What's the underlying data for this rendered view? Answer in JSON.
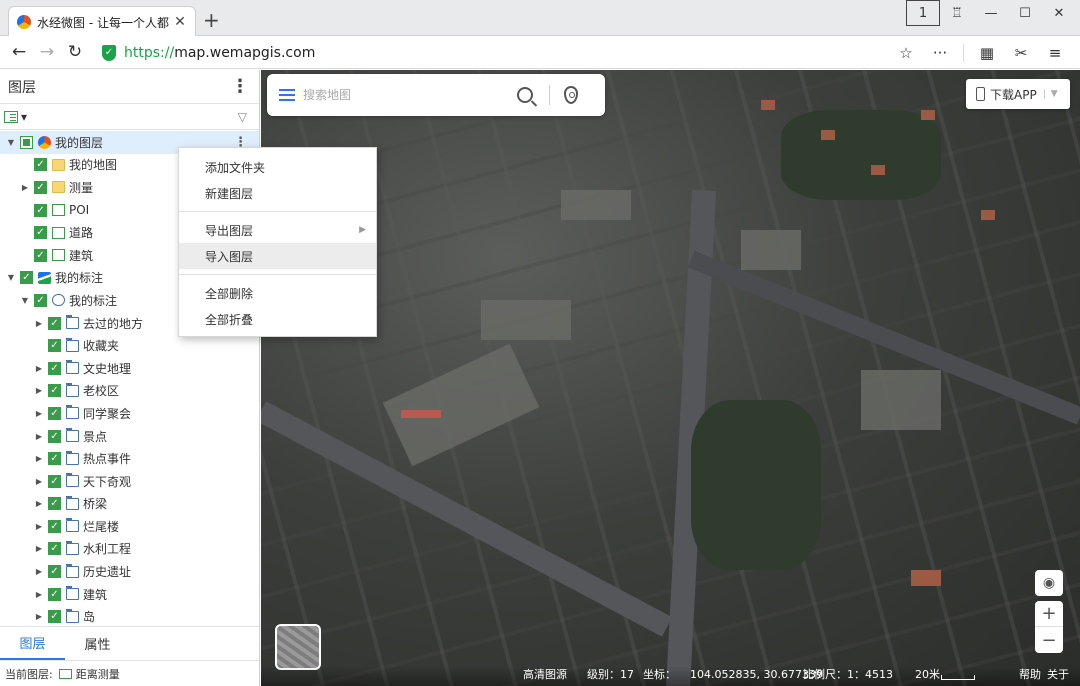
{
  "browser": {
    "tab_title": "水经微图 - 让每一个人都有自",
    "url_scheme": "https://",
    "url_rest": "map.wemapgis.com"
  },
  "panel": {
    "title": "图层",
    "tree": [
      {
        "label": "我的图层",
        "level": 0,
        "arrow": "▼",
        "check": "partial",
        "icon": "globe",
        "selected": true
      },
      {
        "label": "我的地图",
        "level": 1,
        "arrow": "",
        "check": "on",
        "icon": "folder-y"
      },
      {
        "label": "测量",
        "level": 1,
        "arrow": "▶",
        "check": "on",
        "icon": "folder-y"
      },
      {
        "label": "POI",
        "level": 1,
        "arrow": "",
        "check": "on",
        "icon": "poi"
      },
      {
        "label": "道路",
        "level": 1,
        "arrow": "",
        "check": "on",
        "icon": "road"
      },
      {
        "label": "建筑",
        "level": 1,
        "arrow": "",
        "check": "on",
        "icon": "bld"
      },
      {
        "label": "我的标注",
        "level": 0,
        "arrow": "▼",
        "check": "on",
        "icon": "mark"
      },
      {
        "label": "我的标注",
        "level": 1,
        "arrow": "▼",
        "check": "on",
        "icon": "cloud"
      },
      {
        "label": "去过的地方",
        "level": 2,
        "arrow": "▶",
        "check": "on",
        "icon": "folder-b"
      },
      {
        "label": "收藏夹",
        "level": 2,
        "arrow": "",
        "check": "on",
        "icon": "folder-b"
      },
      {
        "label": "文史地理",
        "level": 2,
        "arrow": "▶",
        "check": "on",
        "icon": "folder-b"
      },
      {
        "label": "老校区",
        "level": 2,
        "arrow": "▶",
        "check": "on",
        "icon": "folder-b"
      },
      {
        "label": "同学聚会",
        "level": 2,
        "arrow": "▶",
        "check": "on",
        "icon": "folder-b"
      },
      {
        "label": "景点",
        "level": 2,
        "arrow": "▶",
        "check": "on",
        "icon": "folder-b"
      },
      {
        "label": "热点事件",
        "level": 2,
        "arrow": "▶",
        "check": "on",
        "icon": "folder-b"
      },
      {
        "label": "天下奇观",
        "level": 2,
        "arrow": "▶",
        "check": "on",
        "icon": "folder-b"
      },
      {
        "label": "桥梁",
        "level": 2,
        "arrow": "▶",
        "check": "on",
        "icon": "folder-b"
      },
      {
        "label": "烂尾楼",
        "level": 2,
        "arrow": "▶",
        "check": "on",
        "icon": "folder-b"
      },
      {
        "label": "水利工程",
        "level": 2,
        "arrow": "▶",
        "check": "on",
        "icon": "folder-b"
      },
      {
        "label": "历史遗址",
        "level": 2,
        "arrow": "▶",
        "check": "on",
        "icon": "folder-b"
      },
      {
        "label": "建筑",
        "level": 2,
        "arrow": "▶",
        "check": "on",
        "icon": "folder-b"
      },
      {
        "label": "岛",
        "level": 2,
        "arrow": "▶",
        "check": "on",
        "icon": "folder-b"
      }
    ],
    "bottom_tabs": [
      {
        "label": "图层",
        "active": true
      },
      {
        "label": "属性",
        "active": false
      }
    ],
    "status_label": "当前图层:",
    "status_value": "距离测量"
  },
  "context_menu": {
    "groups": [
      [
        {
          "label": "添加文件夹"
        },
        {
          "label": "新建图层"
        }
      ],
      [
        {
          "label": "导出图层",
          "submenu": true
        },
        {
          "label": "导入图层",
          "hover": true
        }
      ],
      [
        {
          "label": "全部删除"
        },
        {
          "label": "全部折叠"
        }
      ]
    ]
  },
  "map": {
    "search_placeholder": "搜索地图",
    "app_button": "下载APP",
    "status": {
      "source": "高清图源",
      "level_label": "级别：",
      "level_value": "17",
      "coord_label": "坐标：",
      "coord_value": "104.052835, 30.677339",
      "scale_label": "比例尺：",
      "scale_value": "1：4513",
      "scalebar_text": "20米",
      "help": "帮助",
      "about": "关于"
    }
  },
  "colors": {
    "accent": "#2d7ad6",
    "check_green": "#3a9b4a",
    "secure_green": "#1aa34a"
  }
}
